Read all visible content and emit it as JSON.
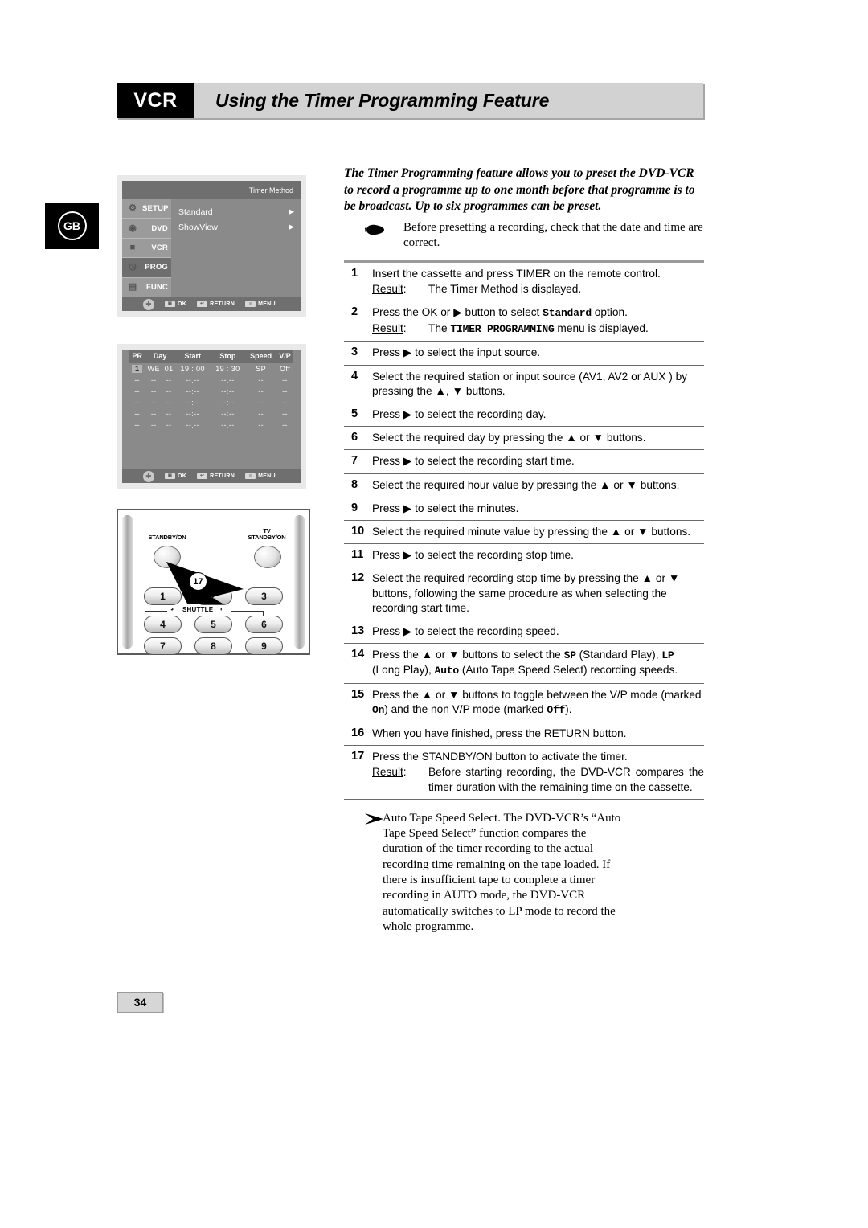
{
  "header": {
    "tag": "VCR",
    "title": "Using the Timer Programming Feature"
  },
  "locale_badge": "GB",
  "page_number": "34",
  "figures": {
    "osd_timer_method": {
      "title": "Timer Method",
      "sidebar": [
        {
          "label": "SETUP",
          "icon": "gear-icon",
          "active": false
        },
        {
          "label": "DVD",
          "icon": "disc-icon",
          "active": false
        },
        {
          "label": "VCR",
          "icon": "cassette-icon",
          "active": false
        },
        {
          "label": "PROG",
          "icon": "clock-icon",
          "active": true
        },
        {
          "label": "FUNC",
          "icon": "hand-icon",
          "active": false
        }
      ],
      "options": [
        {
          "label": "Standard",
          "arrow": "▶"
        },
        {
          "label": "ShowView",
          "arrow": "▶"
        }
      ],
      "footer": [
        {
          "key": "▣",
          "label": "OK"
        },
        {
          "key": "↩",
          "label": "RETURN"
        },
        {
          "key": "≡",
          "label": "MENU"
        }
      ]
    },
    "osd_timer_table": {
      "columns": [
        "PR",
        "Day",
        "",
        "Start",
        "Stop",
        "Speed",
        "V/P"
      ],
      "rows": [
        {
          "pr": "1",
          "day": "WE",
          "date": "01",
          "start": "19 : 00",
          "stop": "19 : 30",
          "speed": "SP",
          "vp": "Off",
          "selected": true
        },
        {
          "pr": "--",
          "day": "--",
          "date": "--",
          "start": "--:--",
          "stop": "--:--",
          "speed": "--",
          "vp": "--",
          "selected": false
        },
        {
          "pr": "--",
          "day": "--",
          "date": "--",
          "start": "--:--",
          "stop": "--:--",
          "speed": "--",
          "vp": "--",
          "selected": false
        },
        {
          "pr": "--",
          "day": "--",
          "date": "--",
          "start": "--:--",
          "stop": "--:--",
          "speed": "--",
          "vp": "--",
          "selected": false
        },
        {
          "pr": "--",
          "day": "--",
          "date": "--",
          "start": "--:--",
          "stop": "--:--",
          "speed": "--",
          "vp": "--",
          "selected": false
        },
        {
          "pr": "--",
          "day": "--",
          "date": "--",
          "start": "--:--",
          "stop": "--:--",
          "speed": "--",
          "vp": "--",
          "selected": false
        }
      ],
      "footer": [
        {
          "key": "▣",
          "label": "OK"
        },
        {
          "key": "↩",
          "label": "RETURN"
        },
        {
          "key": "≡",
          "label": "MENU"
        }
      ]
    },
    "remote": {
      "standby_label": "STANDBY/ON",
      "tv_standby_label_line1": "TV",
      "tv_standby_label_line2": "STANDBY/ON",
      "shuttle_label": "SHUTTLE",
      "callout": "17",
      "keys": [
        "1",
        "2",
        "3",
        "4",
        "5",
        "6",
        "7",
        "8",
        "9"
      ]
    }
  },
  "intro": "The Timer Programming feature allows you to preset the DVD-VCR to record a programme up to one month before that programme is to be broadcast. Up to six programmes can be preset.",
  "note": "Before presetting a recording, check that the date and time are correct.",
  "result_label": "Result",
  "steps": [
    {
      "n": "1",
      "text": "Insert the cassette and press TIMER on the remote control.",
      "result": "The Timer Method is displayed."
    },
    {
      "n": "2",
      "text_a": "Press the OK or ",
      "text_arrow": "▶",
      "text_b": " button to select ",
      "text_mono": "Standard",
      "text_c": " option.",
      "result_a": "The ",
      "result_mono": "TIMER PROGRAMMING",
      "result_b": " menu is displayed."
    },
    {
      "n": "3",
      "text_a": "Press ",
      "text_arrow": "▶",
      "text_b": " to select the input source."
    },
    {
      "n": "4",
      "text": "Select the required station or input source (AV1, AV2 or AUX ) by pressing the ▲, ▼ buttons."
    },
    {
      "n": "5",
      "text_a": "Press ",
      "text_arrow": "▶",
      "text_b": " to select the recording day."
    },
    {
      "n": "6",
      "text": "Select the required day by pressing the ▲ or ▼ buttons."
    },
    {
      "n": "7",
      "text_a": "Press ",
      "text_arrow": "▶",
      "text_b": " to select the recording start time."
    },
    {
      "n": "8",
      "text": "Select the required hour value by pressing the ▲ or ▼ buttons."
    },
    {
      "n": "9",
      "text_a": "Press ",
      "text_arrow": "▶",
      "text_b": " to select the minutes."
    },
    {
      "n": "10",
      "text": "Select the required minute value by pressing the ▲ or ▼ buttons."
    },
    {
      "n": "11",
      "text_a": "Press ",
      "text_arrow": "▶",
      "text_b": " to select the recording stop time."
    },
    {
      "n": "12",
      "text": "Select the required recording stop time by pressing the ▲ or ▼ buttons, following the same procedure as when selecting the recording start time."
    },
    {
      "n": "13",
      "text_a": "Press ",
      "text_arrow": "▶",
      "text_b": " to select the recording speed."
    },
    {
      "n": "14",
      "text_a": "Press the ▲ or ▼ buttons to select the ",
      "mono1": "SP",
      "text_b": " (Standard Play), ",
      "mono2": "LP",
      "text_c": " (Long Play), ",
      "mono3": "Auto",
      "text_d": " (Auto Tape Speed Select) recording speeds."
    },
    {
      "n": "15",
      "text_a": "Press the ▲ or ▼ buttons to toggle between the V/P mode (marked ",
      "mono1": "On",
      "text_b": ") and the non V/P mode (marked ",
      "mono2": "Off",
      "text_c": ")."
    },
    {
      "n": "16",
      "text": "When you have finished, press the RETURN button."
    },
    {
      "n": "17",
      "text": "Press the STANDBY/ON button to activate the timer.",
      "result": "Before starting recording, the DVD-VCR compares the timer duration with the remaining time on the cassette."
    }
  ],
  "tail_note": "Auto Tape Speed Select. The DVD-VCR’s “Auto Tape Speed Select” function compares the duration of the timer recording to the actual recording time remaining on the tape loaded. If there is insufficient tape to complete a timer recording in AUTO mode, the DVD-VCR automatically switches to LP mode to record the whole programme."
}
